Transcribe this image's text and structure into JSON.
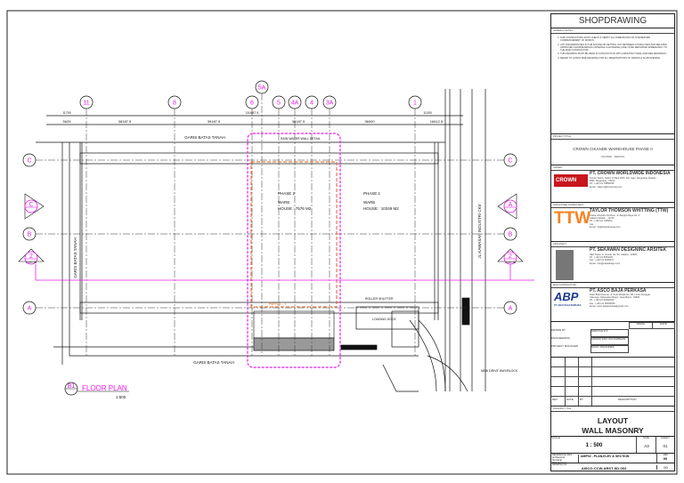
{
  "title_block": {
    "header": "SHOPDRAWING",
    "general_notes_label": "GENERAL NOTES :",
    "notes": [
      "SUB CONTRACTORS MUST CHECK & VERIFY ALL DIMENSIONS ON SITE BEFORE COMMENCEMENT OF WORKS.",
      "ANY DISCREPANCIES IN THE FIGURE OR SETTING OUT BETWEEN CONSULTANS AND RELATED APPROVED SHOPDRAWINGS (INTERNAL & EXTERNAL) ARE TO BE REPORTED IMMEDIATELY TO THE MAIN CONTRACTOR.",
      "THIS DRAWING MUST BE READ IN CONJUNCTION WITH ARCHITECTURAL AND M&E DRAWINGS.",
      "REFER TO LATEST M&E DRAWING FOR ALL PENETRATIONS OF DRAINS & SLAB OPENING."
    ],
    "project_title_label": "PROJECT TITLE :",
    "project_title": "CROWN CIKANDE WAREHOUSE PHASE II",
    "project_location": "CIKANDE - SERANG",
    "owner_label": "OWNER :",
    "owner": {
      "logo": "CROWN",
      "name": "PT. CROWN WORLDWIDE INDONESIA",
      "info": "Taman Tekno, Sektor IX Blok D2/5, Kel. Setu, Tangerang Selatan\nBSD, Tangerang - 15314\nPh    : (+62) 21 75882336\nEmail : sales.id@crownww.com"
    },
    "structure_label": "STRUCTURE CONSULTANT :",
    "structure": {
      "logo": "TTW",
      "name": "TAYLOR THOMSON WHITTING (TTW)",
      "info": "Graha Chandra 3rd Floor, Jl. Bangka Raya No. 6\nJakarta Selatan - 12720\nPh    : (+62) 21 7180011\nFax   : -\nEmail : ttw@ttwindonesia.com"
    },
    "architect_label": "ARCHITECT :",
    "architect": {
      "name": "PT. SEKAWAN DESIGNINC ARSITEK",
      "info": "SEA Tower, Jl. Gunter No. 60, Jakarta - 12960\nPh    : (+62) 21 8353200\nFax   : (+62) 21 8290474\nEmail : info@sekadesign.com"
    },
    "contractor_label": "MAIN CONTRACTOR :",
    "contractor": {
      "logo": "ABP",
      "logo_sub": "PT. ASCO BAJA PERKASA",
      "name": "PT. ASCO BAJA PERKASA",
      "info": "Ruko Bukit Avenue, Jl. Kota Wisata No. 88, Limus Nunggal\nCileungsi, Kabupaten Bogor, Jawa Barat - 16820\nPh    : (+62) 21 82492630\nFax   : (+62) 21 82492630\nEmail : asco.bajaperkasa@gmail.com"
    },
    "paraf_label": "PARAF",
    "date_label": "DATE",
    "drawn_by_label": "DRAWN BY",
    "drawn_by": "HIDAYAH Z.A",
    "engineering_label": "ENGINEERING",
    "engineering": "AHMAD ZAKI ZULKARNAIN",
    "pm_label": "PROJECT MANAGER",
    "pm": "DAUD JOHANNES",
    "rev_label": "REV.",
    "rev_date_label": "DATE",
    "by_label": "BY",
    "desc_label": "DESCRIPTION",
    "drawing_title_label": "DRAWING TITLE :",
    "drawing_title": [
      "LAYOUT",
      "WALL MASONRY"
    ],
    "scale_label": "SCALE",
    "scale": "1 : 500",
    "size_label": "SIZE",
    "size": "A3",
    "sheet_label": "SHEET",
    "sheet": "01",
    "reference_label": "REFERENCE DWG",
    "ref_arch": "Architectural",
    "ref_struct": "Structural",
    "ref_me": "M&E Services",
    "reference": "AMP02 - PLAN,ELEV & SECTION",
    "rev_no_label": "REV",
    "rev_no": "00",
    "drawing_no_label": "DRAWING NO. :",
    "drawing_no": "AISCO-CCW-ARST-SD-004",
    "rev2": "00"
  },
  "drawing": {
    "grid_top": [
      "11",
      "8",
      "6",
      "5A",
      "5",
      "4A",
      "4",
      "3A",
      "1"
    ],
    "grid_side": [
      "C",
      "B",
      "A"
    ],
    "section_left": [
      {
        "id": "C",
        "ref": "-"
      },
      {
        "id": "2",
        "ref": "A-101-00"
      }
    ],
    "section_right": [
      {
        "id": "A",
        "ref": "-"
      },
      {
        "id": "2",
        "ref": "A-101-00"
      }
    ],
    "dims_top": [
      "5625",
      "38187.5",
      "39187.5",
      "38187.5",
      "36000",
      "16612.5"
    ],
    "dims_top2": [
      "11700",
      "110487.5",
      "11000"
    ],
    "boundary_label": "GARIS BATAS TANAH",
    "road_label": "JL.KAWASAN INDUSTRI CKV",
    "phase2": [
      "PHASE 2",
      "WARE",
      "HOUSE : 7576 M2"
    ],
    "phase1": [
      "PHASE 1",
      "WARE",
      "HOUSE : 10349 M2"
    ],
    "partial_label": "PARTIAL - 1",
    "rain_water_label": "RAIN WATER WALL DETAIL",
    "roller_shutter_label": "ROLLER SHUTTER",
    "loading_label": "LOADING DOCK",
    "drive_label": "NEW DRIVE WAY/BLOCK",
    "plan_id": "B1",
    "plan_ref": "-",
    "plan_title": "FLOOR PLAN",
    "plan_scale": "1:500",
    "colors": {
      "annotation": "#e81ee8",
      "revision": "#e8601e",
      "line": "#111111"
    }
  }
}
